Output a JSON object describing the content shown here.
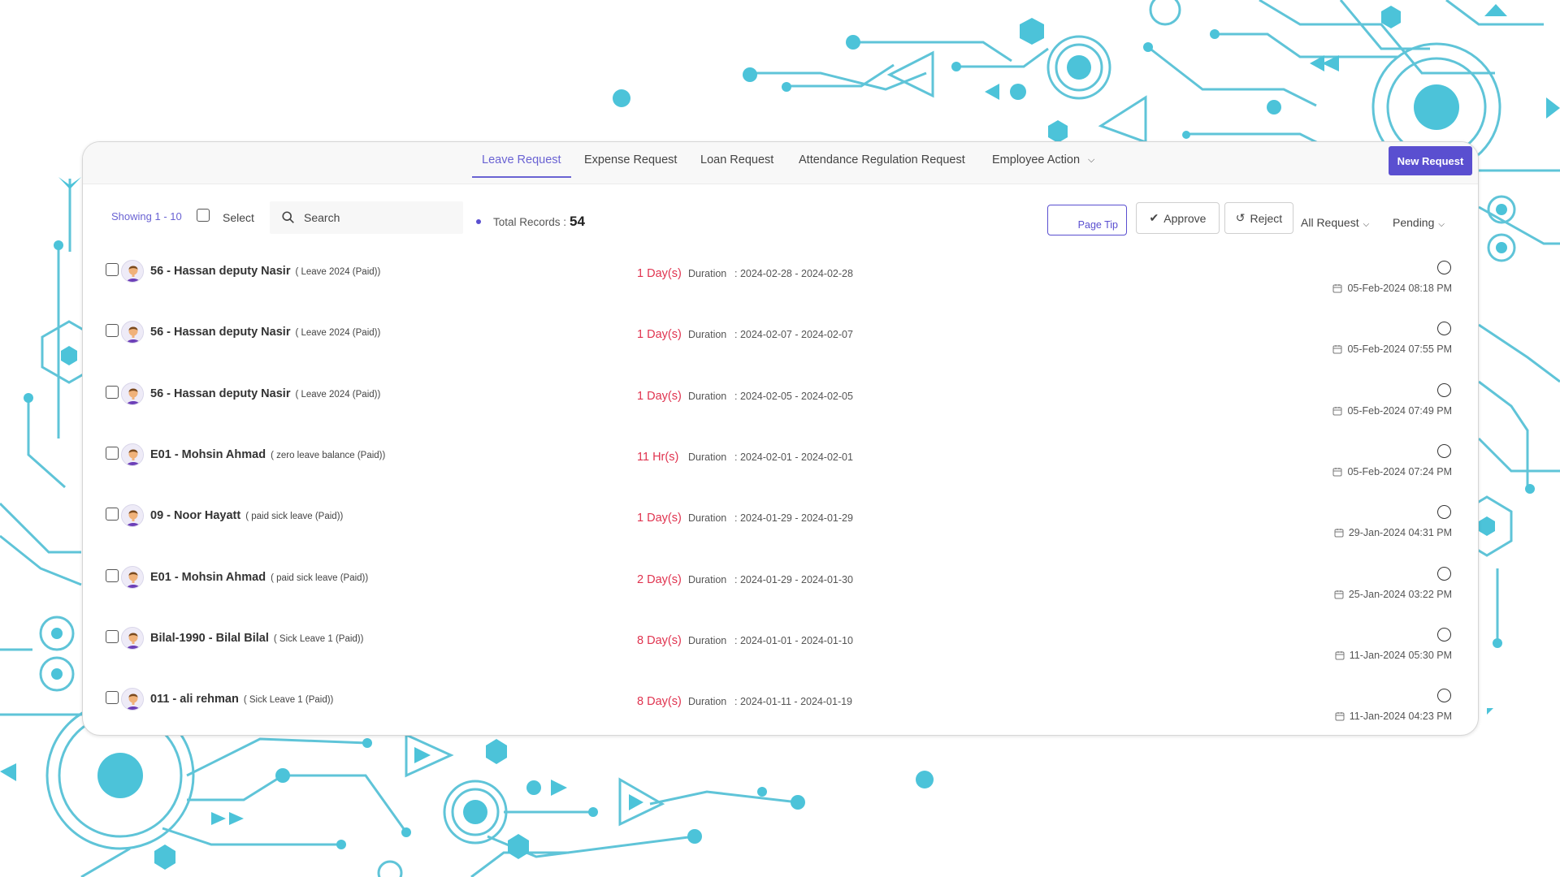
{
  "tabs": [
    {
      "label": "Leave Request",
      "active": true
    },
    {
      "label": "Expense Request",
      "active": false
    },
    {
      "label": "Loan Request",
      "active": false
    },
    {
      "label": "Attendance Regulation Request",
      "active": false
    },
    {
      "label": "Employee Action",
      "active": false,
      "has_dropdown": true
    }
  ],
  "new_request_label": "New Request",
  "toolbar": {
    "showing": "Showing 1 - 10",
    "select_label": "Select",
    "search_placeholder": "Search",
    "total_label": "Total Records :",
    "total_value": "54",
    "page_tip_label": "Page Tip",
    "approve_label": "Approve",
    "reject_label": "Reject",
    "filter_request": "All Request",
    "filter_status": "Pending"
  },
  "rows": [
    {
      "name": "56 - Hassan deputy Nasir",
      "leave": "( Leave 2024 (Paid))",
      "duration": "1 Day(s)",
      "duration_label": "Duration",
      "range": ": 2024-02-28 - 2024-02-28",
      "timestamp": "05-Feb-2024 08:18 PM"
    },
    {
      "name": "56 - Hassan deputy Nasir",
      "leave": "( Leave 2024 (Paid))",
      "duration": "1 Day(s)",
      "duration_label": "Duration",
      "range": ": 2024-02-07 - 2024-02-07",
      "timestamp": "05-Feb-2024 07:55 PM"
    },
    {
      "name": "56 - Hassan deputy Nasir",
      "leave": "( Leave 2024 (Paid))",
      "duration": "1 Day(s)",
      "duration_label": "Duration",
      "range": ": 2024-02-05 - 2024-02-05",
      "timestamp": "05-Feb-2024 07:49 PM"
    },
    {
      "name": "E01 - Mohsin Ahmad",
      "leave": "( zero leave balance (Paid))",
      "duration": "11 Hr(s)",
      "duration_label": "Duration",
      "range": ": 2024-02-01 - 2024-02-01",
      "timestamp": "05-Feb-2024 07:24 PM"
    },
    {
      "name": "09 - Noor Hayatt",
      "leave": "( paid sick leave (Paid))",
      "duration": "1 Day(s)",
      "duration_label": "Duration",
      "range": ": 2024-01-29 - 2024-01-29",
      "timestamp": "29-Jan-2024 04:31 PM"
    },
    {
      "name": "E01 - Mohsin Ahmad",
      "leave": "( paid sick leave (Paid))",
      "duration": "2 Day(s)",
      "duration_label": "Duration",
      "range": ": 2024-01-29 - 2024-01-30",
      "timestamp": "25-Jan-2024 03:22 PM"
    },
    {
      "name": "Bilal-1990 - Bilal Bilal",
      "leave": "( Sick Leave 1 (Paid))",
      "duration": "8 Day(s)",
      "duration_label": "Duration",
      "range": ": 2024-01-01 - 2024-01-10",
      "timestamp": "11-Jan-2024 05:30 PM"
    },
    {
      "name": "011 - ali rehman",
      "leave": "( Sick Leave 1 (Paid))",
      "duration": "8 Day(s)",
      "duration_label": "Duration",
      "range": ": 2024-01-11 - 2024-01-19",
      "timestamp": "11-Jan-2024 04:23 PM"
    }
  ],
  "colors": {
    "accent": "#5a4fd0",
    "duration": "#e0334f",
    "decor": "#4cc3d9"
  }
}
